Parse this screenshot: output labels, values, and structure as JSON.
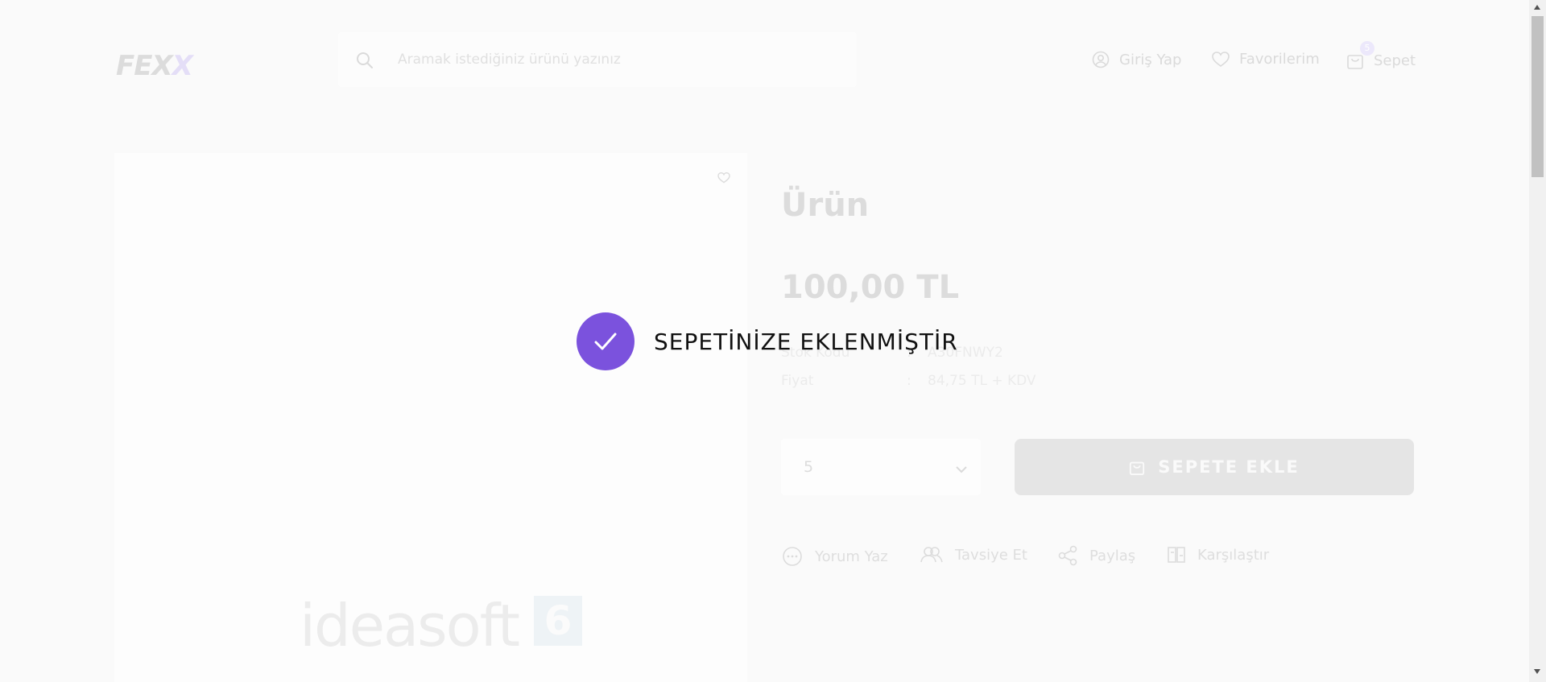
{
  "header": {
    "logo": {
      "part1": "FEX",
      "part2": "X"
    },
    "search_placeholder": "Aramak istediğiniz ürünü yazınız",
    "login_label": "Giriş Yap",
    "favorites_label": "Favorilerim",
    "cart_label": "Sepet",
    "cart_count": "5"
  },
  "product": {
    "title": "Ürün",
    "price": "100,00 TL",
    "info": [
      {
        "label": "Stok Kodu",
        "value": "A30FNWY2"
      },
      {
        "label": "Fiyat",
        "value": "84,75 TL + KDV"
      }
    ],
    "separator": ":",
    "quantity": "5",
    "add_to_cart": "SEPETE EKLE",
    "actions": [
      "Yorum Yaz",
      "Tavsiye Et",
      "Paylaş",
      "Karşılaştır"
    ],
    "image_watermark": "ideasoft",
    "image_watermark_badge": "6"
  },
  "toast": {
    "message": "SEPETİNİZE EKLENMİŞTİR"
  },
  "colors": {
    "accent": "#7b52dd",
    "button_disabled": "#e5e5e5"
  }
}
